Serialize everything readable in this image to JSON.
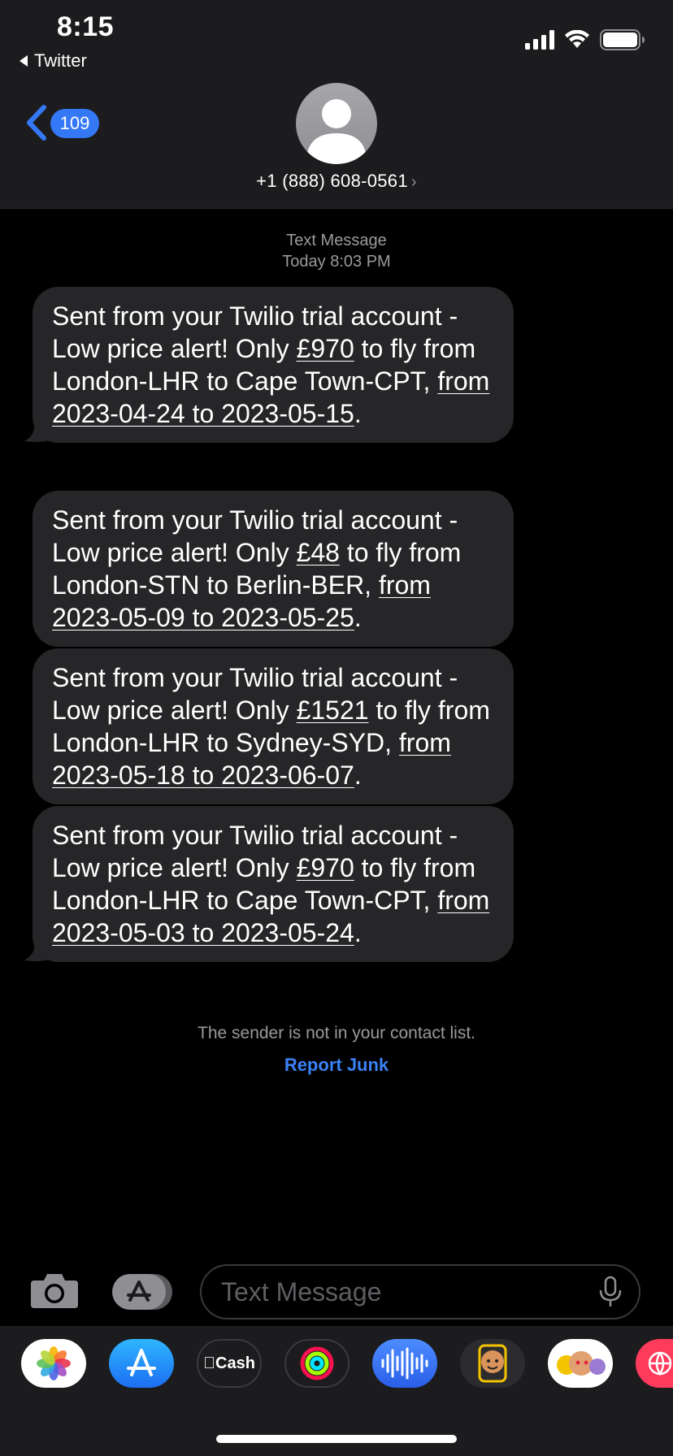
{
  "status_bar": {
    "time": "8:15",
    "back_app": "Twitter"
  },
  "header": {
    "unread_count": "109",
    "contact": "+1 (888) 608-0561",
    "chevron": "›"
  },
  "meta": {
    "type": "Text Message",
    "timestamp_day": "Today",
    "timestamp_time": "8:03 PM"
  },
  "messages": [
    {
      "prefix": "Sent from your Twilio trial account - Low price alert! Only ",
      "price": "£970",
      "mid": " to fly from London-LHR to Cape Town-CPT, ",
      "dates": "from 2023-04-24 to 2023-05-15",
      "end": "."
    },
    {
      "prefix": "Sent from your Twilio trial account - Low price alert! Only ",
      "price": "£48",
      "mid": " to fly from London-STN to Berlin-BER, ",
      "dates": "from 2023-05-09 to 2023-05-25",
      "end": "."
    },
    {
      "prefix": "Sent from your Twilio trial account - Low price alert! Only ",
      "price": "£1521",
      "mid": " to fly from London-LHR to Sydney-SYD, ",
      "dates": "from 2023-05-18 to 2023-06-07",
      "end": "."
    },
    {
      "prefix": "Sent from your Twilio trial account - Low price alert! Only ",
      "price": "£970",
      "mid": " to fly from London-LHR to Cape Town-CPT, ",
      "dates": "from 2023-05-03 to 2023-05-24",
      "end": "."
    }
  ],
  "footer": {
    "notice": "The sender is not in your contact list.",
    "report": "Report Junk"
  },
  "composer": {
    "placeholder": "Text Message"
  },
  "app_drawer": {
    "items": [
      {
        "icon": "photos-icon"
      },
      {
        "icon": "app-store-icon"
      },
      {
        "icon": "apple-cash-icon",
        "label": "Cash"
      },
      {
        "icon": "activity-icon"
      },
      {
        "icon": "voice-memo-icon"
      },
      {
        "icon": "memoji-icon"
      },
      {
        "icon": "animoji-icon"
      },
      {
        "icon": "web-images-icon"
      }
    ]
  },
  "colors": {
    "accent": "#3478f6",
    "bubble": "#262628",
    "header": "#1c1c1e"
  }
}
